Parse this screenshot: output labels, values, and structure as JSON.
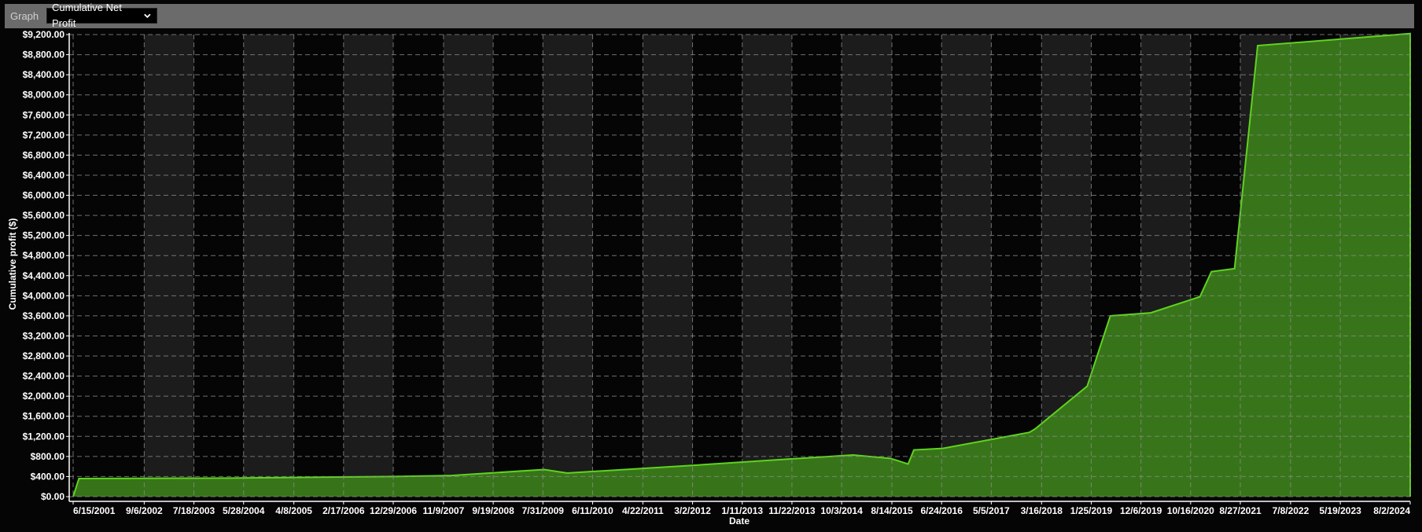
{
  "toolbar": {
    "label": "Graph",
    "select_value": "Cumulative Net Profit",
    "select_icon": "chevron-down-icon"
  },
  "colors": {
    "background": "#050505",
    "band_alt": "#1c1c1c",
    "line": "#5fd31f",
    "fill": "#3a7a1a",
    "grid": "#8a8a8a",
    "toolbar": "#6b6b6b"
  },
  "chart_data": {
    "type": "area",
    "title": "",
    "xlabel": "Date",
    "ylabel": "Cumulative profit ($)",
    "ylim": [
      0,
      9200
    ],
    "grid": true,
    "legend": "none",
    "y_ticks": [
      0,
      400,
      800,
      1200,
      1600,
      2000,
      2400,
      2800,
      3200,
      3600,
      4000,
      4400,
      4800,
      5200,
      5600,
      6000,
      6400,
      6800,
      7200,
      7600,
      8000,
      8400,
      8800,
      9200
    ],
    "y_tick_labels": [
      "$0.00",
      "$400.00",
      "$800.00",
      "$1,200.00",
      "$1,600.00",
      "$2,000.00",
      "$2,400.00",
      "$2,800.00",
      "$3,200.00",
      "$3,600.00",
      "$4,000.00",
      "$4,400.00",
      "$4,800.00",
      "$5,200.00",
      "$5,600.00",
      "$6,000.00",
      "$6,400.00",
      "$6,800.00",
      "$7,200.00",
      "$7,600.00",
      "$8,000.00",
      "$8,400.00",
      "$8,800.00",
      "$9,200.00"
    ],
    "x_tick_labels": [
      "6/15/2001",
      "9/6/2002",
      "7/18/2003",
      "5/28/2004",
      "4/8/2005",
      "2/17/2006",
      "12/29/2006",
      "11/9/2007",
      "9/19/2008",
      "7/31/2009",
      "6/11/2010",
      "4/22/2011",
      "3/2/2012",
      "1/11/2013",
      "11/22/2013",
      "10/3/2014",
      "8/14/2015",
      "6/24/2016",
      "5/5/2017",
      "3/16/2018",
      "1/25/2019",
      "12/6/2019",
      "10/16/2020",
      "8/27/2021",
      "7/8/2022",
      "5/19/2023",
      "8/2/2024"
    ],
    "x_tick_years": [
      2001.45,
      2002.68,
      2003.54,
      2004.4,
      2005.27,
      2006.13,
      2006.99,
      2007.86,
      2008.72,
      2009.58,
      2010.44,
      2011.31,
      2012.17,
      2013.03,
      2013.89,
      2014.75,
      2015.62,
      2016.48,
      2017.34,
      2018.21,
      2019.07,
      2019.93,
      2020.79,
      2021.65,
      2022.52,
      2023.38,
      2024.59
    ],
    "xlim_years": [
      2001.45,
      2024.59
    ],
    "series": [
      {
        "name": "Cumulative Net Profit",
        "x_years": [
          2001.45,
          2001.55,
          2004.2,
          2007.0,
          2008.0,
          2009.6,
          2010.0,
          2012.0,
          2014.0,
          2014.95,
          2015.6,
          2015.9,
          2016.0,
          2016.5,
          2018.0,
          2018.1,
          2019.0,
          2019.4,
          2020.1,
          2020.95,
          2021.15,
          2021.55,
          2021.95,
          2024.59
        ],
        "values": [
          0,
          360,
          370,
          400,
          420,
          540,
          470,
          610,
          760,
          830,
          760,
          650,
          930,
          960,
          1280,
          1350,
          2200,
          3600,
          3660,
          3980,
          4480,
          4540,
          8980,
          9220
        ]
      }
    ]
  }
}
